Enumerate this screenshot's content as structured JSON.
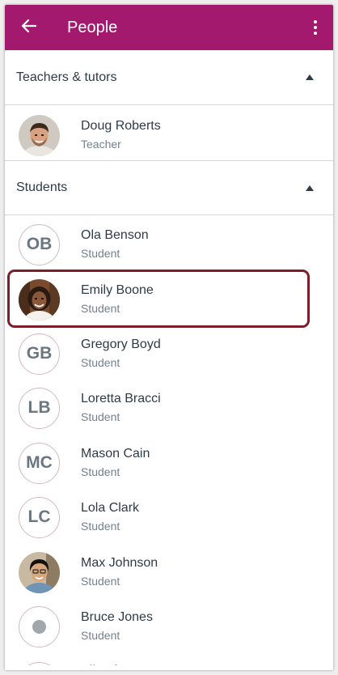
{
  "app_bar": {
    "title": "People",
    "color": "#a3196e",
    "back_icon": "arrow-left-icon",
    "menu_icon": "more-vertical-icon"
  },
  "sections": [
    {
      "title": "Teachers & tutors",
      "expanded": true,
      "people": [
        {
          "name": "Doug Roberts",
          "role": "Teacher",
          "avatar": "photo"
        }
      ]
    },
    {
      "title": "Students",
      "expanded": true,
      "people": [
        {
          "name": "Ola Benson",
          "role": "Student",
          "initials": "OB"
        },
        {
          "name": "Emily Boone",
          "role": "Student",
          "avatar": "photo",
          "highlighted": true
        },
        {
          "name": "Gregory Boyd",
          "role": "Student",
          "initials": "GB"
        },
        {
          "name": "Loretta Bracci",
          "role": "Student",
          "initials": "LB"
        },
        {
          "name": "Mason Cain",
          "role": "Student",
          "initials": "MC"
        },
        {
          "name": "Lola Clark",
          "role": "Student",
          "initials": "LC"
        },
        {
          "name": "Max Johnson",
          "role": "Student",
          "avatar": "photo"
        },
        {
          "name": "Bruce Jones",
          "role": "Student",
          "avatar": "placeholder"
        },
        {
          "name": "Eli Lofton",
          "role": "",
          "partially_visible": true
        }
      ]
    }
  ],
  "colors": {
    "highlight_border": "#7d1e2c",
    "initials_border": "#d7b7c4",
    "text_primary": "#2d3b45",
    "text_secondary": "#73818c"
  }
}
